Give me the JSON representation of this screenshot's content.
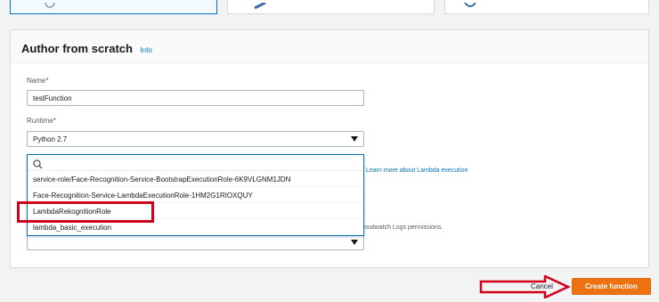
{
  "panel": {
    "title": "Author from scratch",
    "info": "Info"
  },
  "name_field": {
    "label": "Name*",
    "value": "testFunction"
  },
  "runtime_field": {
    "label": "Runtime*",
    "selected": "Python 2.7"
  },
  "role_dropdown": {
    "search_value": "",
    "options": [
      "service-role/Face-Recognition-Service-BootstrapExecutionRole-6K9VLGNM1JDN",
      "Face-Recognition-Service-LambdaExecutionRole-1HM2G1RIOXQUY",
      "LambdaRekognitionRole",
      "lambda_basic_execution"
    ],
    "highlighted": "LambdaRekognitionRole"
  },
  "side_texts": {
    "learn_more": "Learn more about Lambda execution",
    "logs_permissions": "oudwatch Logs permissions."
  },
  "footer": {
    "cancel": "Cancel",
    "create": "Create function"
  },
  "colors": {
    "accent": "#0073bb",
    "primary_button": "#ec7211",
    "annotation_red": "#d0021b"
  }
}
